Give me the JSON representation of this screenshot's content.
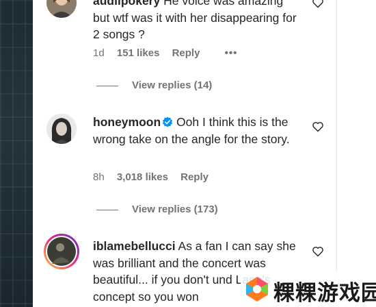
{
  "comments": [
    {
      "username": "audiipokery",
      "text": "He voice was amazing but wtf was it with her disappearing for 2 songs ?",
      "time": "1d",
      "likes": "151 likes",
      "reply": "Reply",
      "more": "•••",
      "view_replies": "View replies (14)"
    },
    {
      "username": "honeymoon",
      "verified": true,
      "text": "Ooh I think this is the wrong take on the angle for the story.",
      "time": "8h",
      "likes": "3,018 likes",
      "reply": "Reply",
      "view_replies": "View replies (173)"
    },
    {
      "username": "iblamebellucci",
      "text": "As a fan I can say she was brilliant and the concert was beautiful... if you don't und Lana's concept so you won"
    }
  ],
  "watermark": {
    "text": "粿粿游戏园"
  },
  "colors": {
    "text": "#262626",
    "muted": "#737373",
    "verified": "#0095f6"
  },
  "icons": [
    "heart-outline-icon",
    "verified-badge-icon",
    "more-options-icon"
  ]
}
